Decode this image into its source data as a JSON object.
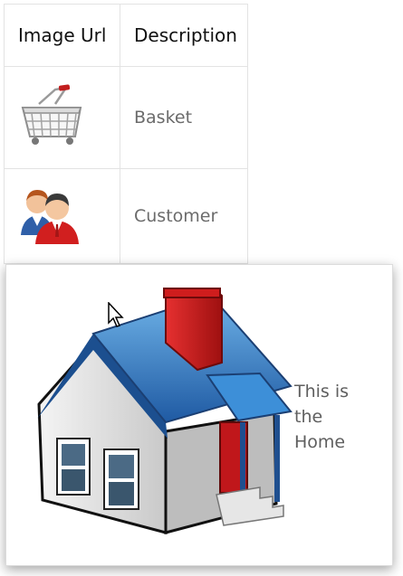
{
  "table": {
    "headers": {
      "image_url": "Image Url",
      "description": "Description"
    },
    "rows": [
      {
        "icon": "shopping-basket-icon",
        "description": "Basket"
      },
      {
        "icon": "customer-users-icon",
        "description": "Customer"
      }
    ]
  },
  "popup": {
    "icon": "home-house-icon",
    "text": "This is the Home"
  },
  "colors": {
    "border": "#e3e3e3",
    "description_text": "#6b6b6b",
    "house_roof": "#2f77c2",
    "chimney": "#d61a1a"
  }
}
